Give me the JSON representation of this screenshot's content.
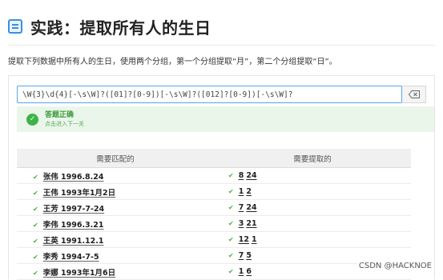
{
  "header": {
    "title": "实践：提取所有人的生日",
    "description": "提取下列数据中所有人的生日，使用两个分组，第一个分组提取“月”，第二个分组提取“日”。"
  },
  "regex": {
    "value": "\\W{3}\\d{4}[-\\s\\W]?([01]?[0-9])[-\\s\\W]?([012]?[0-9])[-\\s\\W]?"
  },
  "result": {
    "title": "答题正确",
    "subtitle": "点击进入下一关"
  },
  "table": {
    "col_match": "需要匹配的",
    "col_extract": "需要提取的",
    "rows": [
      {
        "text": "张伟 1996.8.24",
        "g1": "8",
        "g2": "24"
      },
      {
        "text": "王伟 1993年1月2日",
        "g1": "1",
        "g2": "2"
      },
      {
        "text": "王芳 1997-7-24",
        "g1": "7",
        "g2": "24"
      },
      {
        "text": "李伟 1996.3.21",
        "g1": "3",
        "g2": "21"
      },
      {
        "text": "王英 1991.12.1",
        "g1": "12",
        "g2": "1"
      },
      {
        "text": "李秀 1994-7-5",
        "g1": "7",
        "g2": "5"
      },
      {
        "text": "李娜 1993年1月6日",
        "g1": "1",
        "g2": "6"
      }
    ]
  },
  "watermark": "CSDN @HACKNOE",
  "colors": {
    "accent": "#3a8ee6",
    "success": "#3cb34a"
  }
}
